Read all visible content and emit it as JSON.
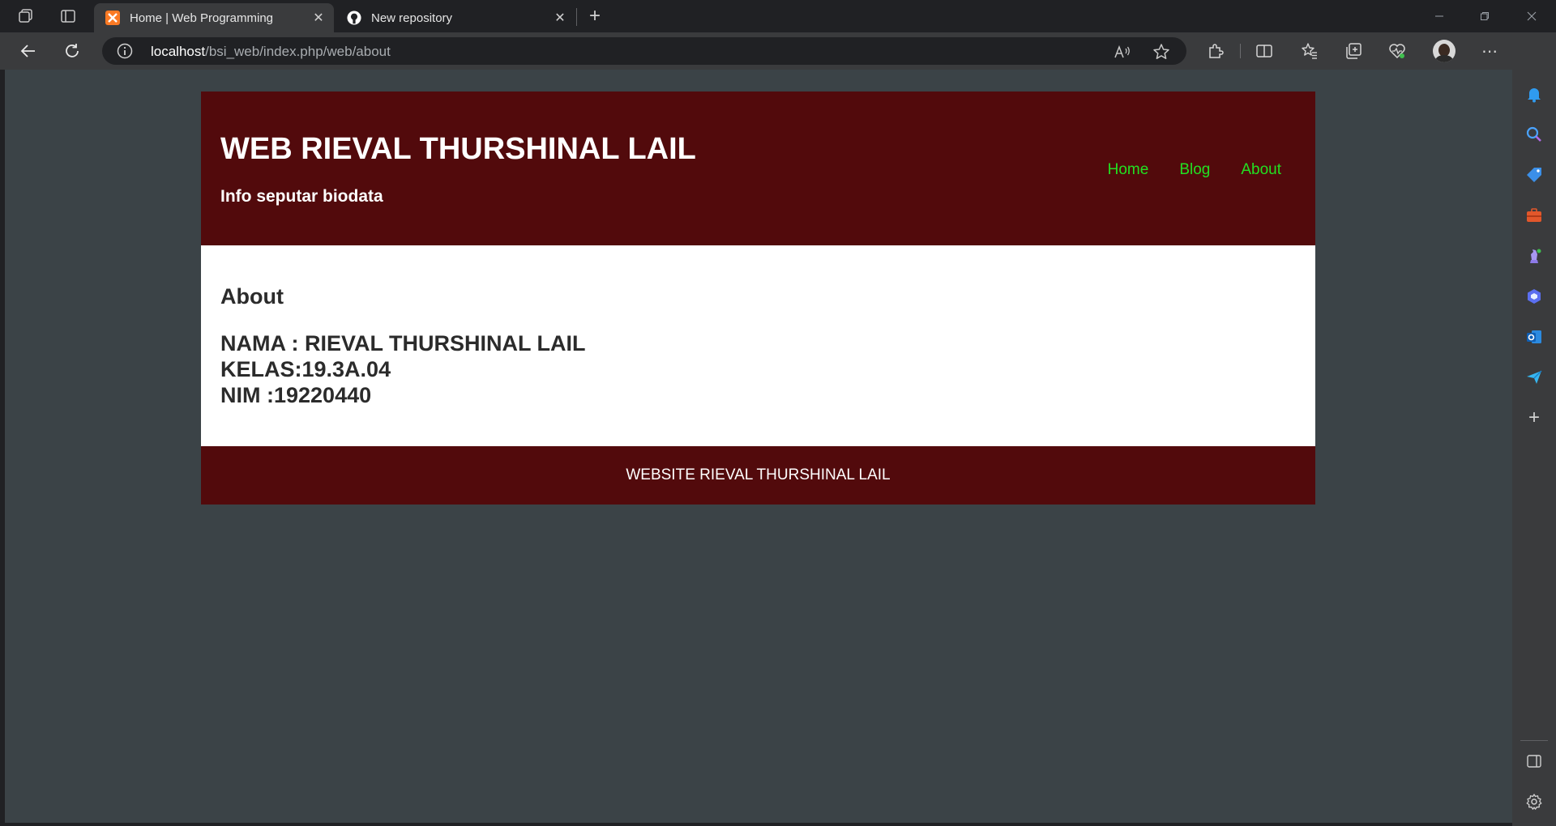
{
  "browser": {
    "tabs": [
      {
        "title": "Home | Web Programming",
        "favicon": "xampp-icon",
        "active": true
      },
      {
        "title": "New repository",
        "favicon": "github-icon",
        "active": false
      }
    ],
    "address": {
      "host": "localhost",
      "path": "/bsi_web/index.php/web/about"
    },
    "accent_color": "#2a5ba8"
  },
  "site": {
    "title": "WEB RIEVAL THURSHINAL LAIL",
    "subtitle": "Info seputar biodata",
    "nav": [
      {
        "label": "Home"
      },
      {
        "label": "Blog"
      },
      {
        "label": "About"
      }
    ],
    "content": {
      "heading": "About",
      "lines": [
        "NAMA : RIEVAL THURSHINAL LAIL",
        "KELAS:19.3A.04",
        "NIM :19220440"
      ]
    },
    "footer": "WEBSITE RIEVAL THURSHINAL LAIL",
    "colors": {
      "header_bg": "#520a0c",
      "nav_link": "#22e022",
      "page_bg": "#3b4347"
    }
  }
}
